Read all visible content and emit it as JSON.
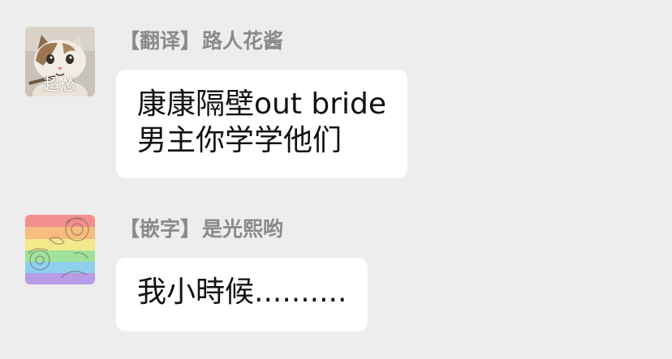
{
  "messages": [
    {
      "sender": {
        "tag": "【翻译】",
        "name": "路人花酱"
      },
      "avatar": {
        "icon": "cat-avatar-icon",
        "caption": "超怂"
      },
      "lines": [
        "康康隔壁out bride",
        "男主你学学他们"
      ]
    },
    {
      "sender": {
        "tag": "【嵌字】",
        "name": "是光熙哟"
      },
      "avatar": {
        "icon": "rainbow-flower-avatar-icon"
      },
      "lines": [
        "我小時候.........."
      ]
    }
  ],
  "colors": {
    "background": "#ededed",
    "bubble": "#ffffff",
    "sender_name": "#8a8a8a",
    "message_text": "#111111"
  }
}
